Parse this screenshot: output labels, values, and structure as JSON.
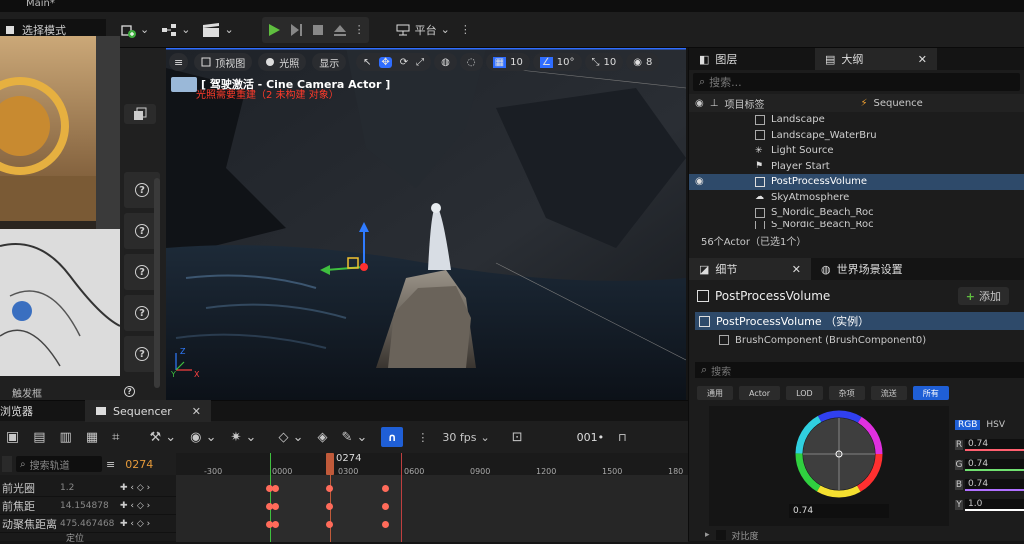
{
  "window": {
    "title": "Main*"
  },
  "toolbar": {
    "mode_label": "选择模式",
    "platform_label": "平台"
  },
  "viewport": {
    "menu_icon": "hamburger-icon",
    "view_mode": "顶视图",
    "lighting": "光照",
    "show": "显示",
    "grid_snap": "10",
    "rotate_snap": "10°",
    "scale_snap": "10",
    "camera_speed": "8",
    "pilot_text": "[ 驾驶激活 - Cine Camera Actor ]",
    "warning_text": "光照需要重建（2 未构建 对象）"
  },
  "left_panel": {
    "bottom_label": "触发框"
  },
  "sequencer": {
    "content_browser_tab": "浏览器",
    "tab_label": "Sequencer",
    "fps_label": "30 fps",
    "frame_display": "001",
    "search_placeholder": "搜索轨道",
    "current_frame": "0274",
    "playhead_label": "0274",
    "ruler": [
      "-300",
      "0000",
      "0300",
      "0600",
      "0900",
      "1200",
      "1500",
      "180"
    ],
    "tracks": [
      {
        "name": "前光圈",
        "value": "1.2"
      },
      {
        "name": "前焦距",
        "value": "14.154878"
      },
      {
        "name": "动聚焦距离",
        "value": "475.467468"
      }
    ],
    "footer_label": "定位"
  },
  "outliner": {
    "tab_layers": "图层",
    "tab_outliner": "大纲",
    "search_placeholder": "搜索...",
    "col_label": "项目标签",
    "col_sequence": "Sequence",
    "items": [
      "Landscape",
      "Landscape_WaterBru",
      "Light Source",
      "Player Start",
      "PostProcessVolume",
      "SkyAtmosphere",
      "S_Nordic_Beach_Roc",
      "S_Nordic_Beach_Roc"
    ],
    "actor_count": "56个Actor（已选1个）"
  },
  "details": {
    "tab_details": "细节",
    "tab_world": "世界场景设置",
    "object_name": "PostProcessVolume",
    "add_label": "添加",
    "instance_label": "PostProcessVolume （实例）",
    "component_label": "BrushComponent (BrushComponent0)",
    "search_placeholder": "搜索",
    "filters": [
      "通用",
      "Actor",
      "LOD",
      "杂项",
      "流送",
      "所有"
    ],
    "color_tabs": [
      "RGB",
      "HSV"
    ],
    "channels": [
      {
        "name": "R",
        "value": "0.74"
      },
      {
        "name": "G",
        "value": "0.74"
      },
      {
        "name": "B",
        "value": "0.74"
      },
      {
        "name": "Y",
        "value": "1.0"
      }
    ],
    "wheel_value": "0.74",
    "contrast_label": "对比度"
  }
}
